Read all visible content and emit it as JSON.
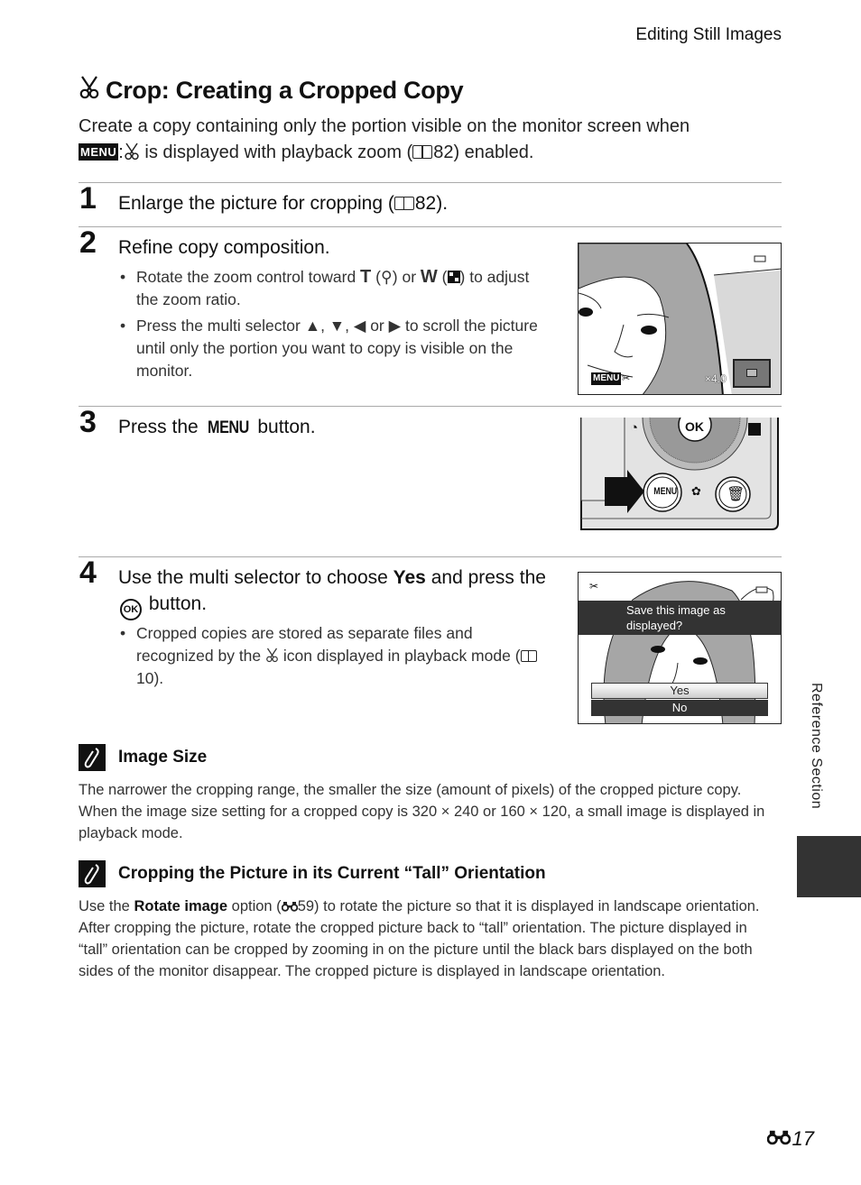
{
  "header": {
    "running_head": "Editing Still Images"
  },
  "title": {
    "text": "Crop: Creating a Cropped Copy",
    "icon": "scissors-icon"
  },
  "intro": {
    "line1": "Create a copy containing only the portion visible on the monitor screen when",
    "menu_badge": "MENU",
    "separator": ":",
    "part2": " is displayed with playback zoom (",
    "ref": "82",
    "part3": ") enabled."
  },
  "steps": [
    {
      "number": "1",
      "text_pre": "Enlarge the picture for cropping (",
      "ref": "82",
      "text_post": ")."
    },
    {
      "number": "2",
      "text": "Refine copy composition.",
      "bullets": [
        {
          "pre": "Rotate the zoom control toward ",
          "T": "T",
          "mid1": " (",
          "mid2": ") or ",
          "W": "W",
          "mid3": " (",
          "post": ") to adjust the zoom ratio."
        },
        {
          "pre": "Press the multi selector ",
          "up": "▲",
          "c1": ", ",
          "down": "▼",
          "c2": ", ",
          "left": "◀",
          "or": " or ",
          "right": "▶",
          "post": " to scroll the picture until only the portion you want to copy is visible on the monitor."
        }
      ],
      "screen": {
        "menu_label": "MENU",
        "zoom_label": "×4.0"
      }
    },
    {
      "number": "3",
      "text_pre": "Press the ",
      "menu": "MENU",
      "text_post": " button.",
      "camera": {
        "ok_label": "OK",
        "menu_label": "MENU"
      }
    },
    {
      "number": "4",
      "text_pre": "Use the multi selector to choose ",
      "bold": "Yes",
      "text_mid": " and press the ",
      "ok": "OK",
      "text_post": " button.",
      "bullets": [
        {
          "pre": "Cropped copies are stored as separate files and recognized by the ",
          "post": " icon displayed in playback mode (",
          "ref": "10",
          "end": ")."
        }
      ],
      "screen": {
        "prompt": "Save this image as displayed?",
        "options": [
          "Yes",
          "No"
        ],
        "selected": "Yes"
      }
    }
  ],
  "notes": [
    {
      "title": "Image Size",
      "icon": "pencil-note-icon",
      "body": "The narrower the cropping range, the smaller the size (amount of pixels) of the cropped picture copy. When the image size setting for a cropped copy is 320 × 240 or 160 × 120, a small image is displayed in playback mode."
    },
    {
      "title": "Cropping the Picture in its Current “Tall” Orientation",
      "icon": "pencil-note-icon",
      "body_pre": "Use the ",
      "body_bold": "Rotate image",
      "body_mid": " option (",
      "ref": "59",
      "body_post": ") to rotate the picture so that it is displayed in landscape orientation. After cropping the picture, rotate the cropped picture back to “tall” orientation. The picture displayed in “tall” orientation can be cropped by zooming in on the picture until the black bars displayed on the both sides of the monitor disappear. The cropped picture is displayed in landscape orientation."
    }
  ],
  "side_tab": {
    "label": "Reference Section"
  },
  "footer": {
    "page_number": "17",
    "icon": "binoculars-icon"
  }
}
